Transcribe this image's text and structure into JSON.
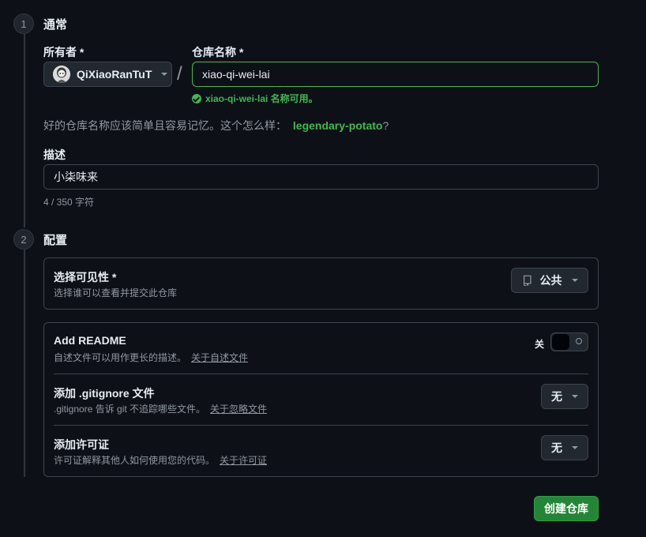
{
  "sections": {
    "general": {
      "number": "1",
      "title": "通常"
    },
    "config": {
      "number": "2",
      "title": "配置"
    }
  },
  "owner": {
    "label": "所有者 *",
    "name": "QiXiaoRanTuT"
  },
  "separator": "/",
  "repo": {
    "label": "仓库名称 *",
    "value": "xiao-qi-wei-lai",
    "availability": "xiao-qi-wei-lai 名称可用。"
  },
  "suggestion": {
    "text": "好的仓库名称应该简单且容易记忆。这个怎么样：",
    "name": "legendary-potato",
    "end": "?"
  },
  "description": {
    "label": "描述",
    "value": "小柒味来",
    "counter": "4 / 350 字符"
  },
  "visibility": {
    "title": "选择可见性 *",
    "desc": "选择谁可以查看并提交此仓库",
    "value": "公共"
  },
  "readme": {
    "title": "Add README",
    "desc": "自述文件可以用作更长的描述。",
    "link": "关于自述文件",
    "state_label": "关",
    "enabled": false
  },
  "gitignore": {
    "title": "添加 .gitignore 文件",
    "desc": ".gitignore 告诉 git 不追踪哪些文件。",
    "link": "关于忽略文件",
    "value": "无"
  },
  "license": {
    "title": "添加许可证",
    "desc": "许可证解释其他人如何使用您的代码。",
    "link": "关于许可证",
    "value": "无"
  },
  "create_button": "创建仓库",
  "colors": {
    "background": "#0d1117",
    "accent_green": "#3fb950",
    "button_green": "#238636",
    "border": "#3d444d"
  }
}
